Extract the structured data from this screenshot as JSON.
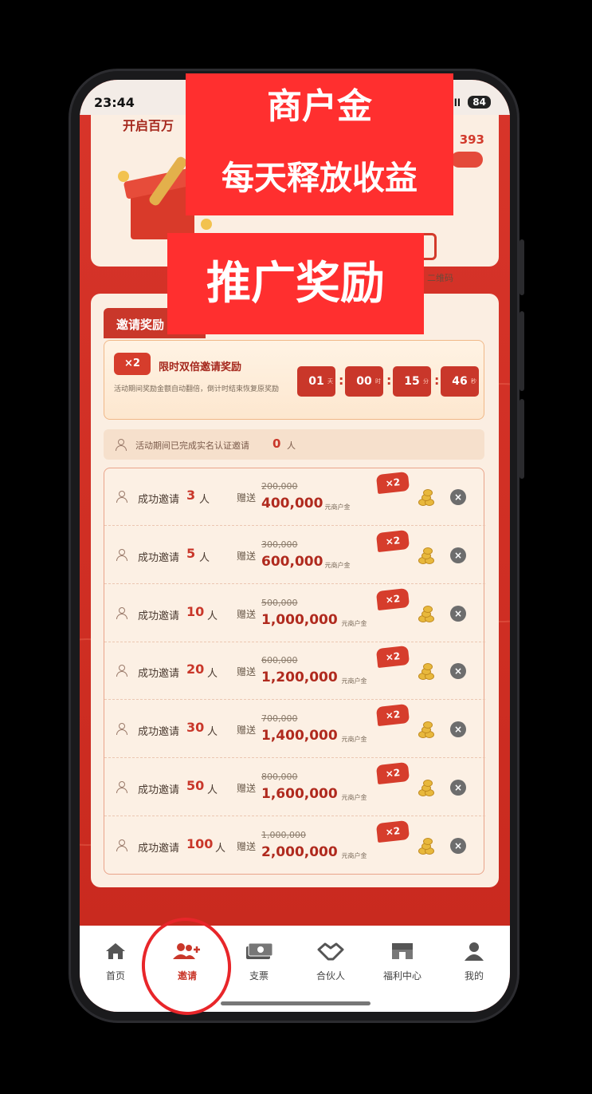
{
  "status_bar": {
    "time": "23:44",
    "signal": "ull",
    "battery": "84"
  },
  "top_card": {
    "title_fragment": "开启百万",
    "number_fragment": "393",
    "qr_label": "二维码"
  },
  "invite": {
    "section_title": "邀请奖励",
    "promo": {
      "badge": "×2",
      "title": "限时双倍邀请奖励",
      "description": "活动期间奖励金额自动翻倍，倒计时结束恢复原奖励",
      "countdown": [
        {
          "value": "01",
          "unit": "天"
        },
        {
          "value": "00",
          "unit": "时"
        },
        {
          "value": "15",
          "unit": "分"
        },
        {
          "value": "46",
          "unit": "秒"
        }
      ],
      "separator": ":"
    },
    "stats": {
      "prefix": "活动期间已完成实名认证邀请",
      "count": "0",
      "suffix": "人"
    },
    "tiers": [
      {
        "label": "成功邀请",
        "count": "3",
        "unit": "人",
        "gift": "赠送",
        "old": "200,000",
        "amount": "400,000",
        "currency": "元商户金",
        "badge": "×2"
      },
      {
        "label": "成功邀请",
        "count": "5",
        "unit": "人",
        "gift": "赠送",
        "old": "300,000",
        "amount": "600,000",
        "currency": "元商户金",
        "badge": "×2"
      },
      {
        "label": "成功邀请",
        "count": "10",
        "unit": "人",
        "gift": "赠送",
        "old": "500,000",
        "amount": "1,000,000",
        "currency": "元商户金",
        "badge": "×2"
      },
      {
        "label": "成功邀请",
        "count": "20",
        "unit": "人",
        "gift": "赠送",
        "old": "600,000",
        "amount": "1,200,000",
        "currency": "元商户金",
        "badge": "×2"
      },
      {
        "label": "成功邀请",
        "count": "30",
        "unit": "人",
        "gift": "赠送",
        "old": "700,000",
        "amount": "1,400,000",
        "currency": "元商户金",
        "badge": "×2"
      },
      {
        "label": "成功邀请",
        "count": "50",
        "unit": "人",
        "gift": "赠送",
        "old": "800,000",
        "amount": "1,600,000",
        "currency": "元商户金",
        "badge": "×2"
      },
      {
        "label": "成功邀请",
        "count": "100",
        "unit": "人",
        "gift": "赠送",
        "old": "1,000,000",
        "amount": "2,000,000",
        "currency": "元商户金",
        "badge": "×2"
      }
    ],
    "close_symbol": "×"
  },
  "tabbar": [
    {
      "label": "首页",
      "icon": "home-icon",
      "active": false
    },
    {
      "label": "邀请",
      "icon": "add-user-icon",
      "active": true
    },
    {
      "label": "支票",
      "icon": "cash-icon",
      "active": false
    },
    {
      "label": "合伙人",
      "icon": "handshake-icon",
      "active": false
    },
    {
      "label": "福利中心",
      "icon": "store-icon",
      "active": false
    },
    {
      "label": "我的",
      "icon": "profile-icon",
      "active": false
    }
  ],
  "overlays": {
    "line1": "商户金",
    "line2": "每天释放收益",
    "line3": "推广奖励"
  },
  "colors": {
    "brand_red": "#c9372a",
    "overlay_red": "#ff2f2f",
    "card_bg": "#fbeee2"
  }
}
